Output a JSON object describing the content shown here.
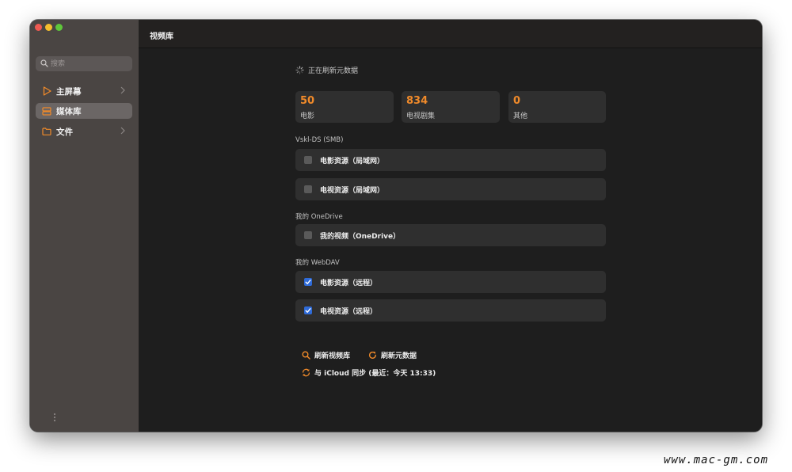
{
  "sidebar": {
    "search_placeholder": "搜索",
    "items": [
      {
        "label": "主屏幕",
        "icon": "play-icon",
        "has_chevron": true
      },
      {
        "label": "媒体库",
        "icon": "library-icon",
        "active": true
      },
      {
        "label": "文件",
        "icon": "folder-icon",
        "has_chevron": true
      }
    ]
  },
  "header": {
    "title": "视频库"
  },
  "status_text": "正在刷新元数据",
  "stats": [
    {
      "value": "50",
      "label": "电影"
    },
    {
      "value": "834",
      "label": "电视剧集"
    },
    {
      "value": "0",
      "label": "其他"
    }
  ],
  "sources": [
    {
      "name": "Vskl-DS (SMB)",
      "items": [
        {
          "label": "电影资源（局域网）",
          "checked": false
        },
        {
          "label": "电视资源（局域网）",
          "checked": false
        }
      ]
    },
    {
      "name": "我的 OneDrive",
      "items": [
        {
          "label": "我的视频（OneDrive）",
          "checked": false
        }
      ]
    },
    {
      "name": "我的 WebDAV",
      "items": [
        {
          "label": "电影资源（远程）",
          "checked": true
        },
        {
          "label": "电视资源（远程）",
          "checked": true
        }
      ]
    }
  ],
  "actions": {
    "refresh_library": "刷新视频库",
    "refresh_metadata": "刷新元数据",
    "icloud_sync": "与 iCloud 同步 (最近：今天 13:33)"
  },
  "watermark": "www.mac-gm.com",
  "colors": {
    "accent": "#f08a2a",
    "checkbox_checked": "#2f6bd8",
    "sidebar_bg": "#4a4543",
    "main_bg": "#1e1e1e"
  }
}
